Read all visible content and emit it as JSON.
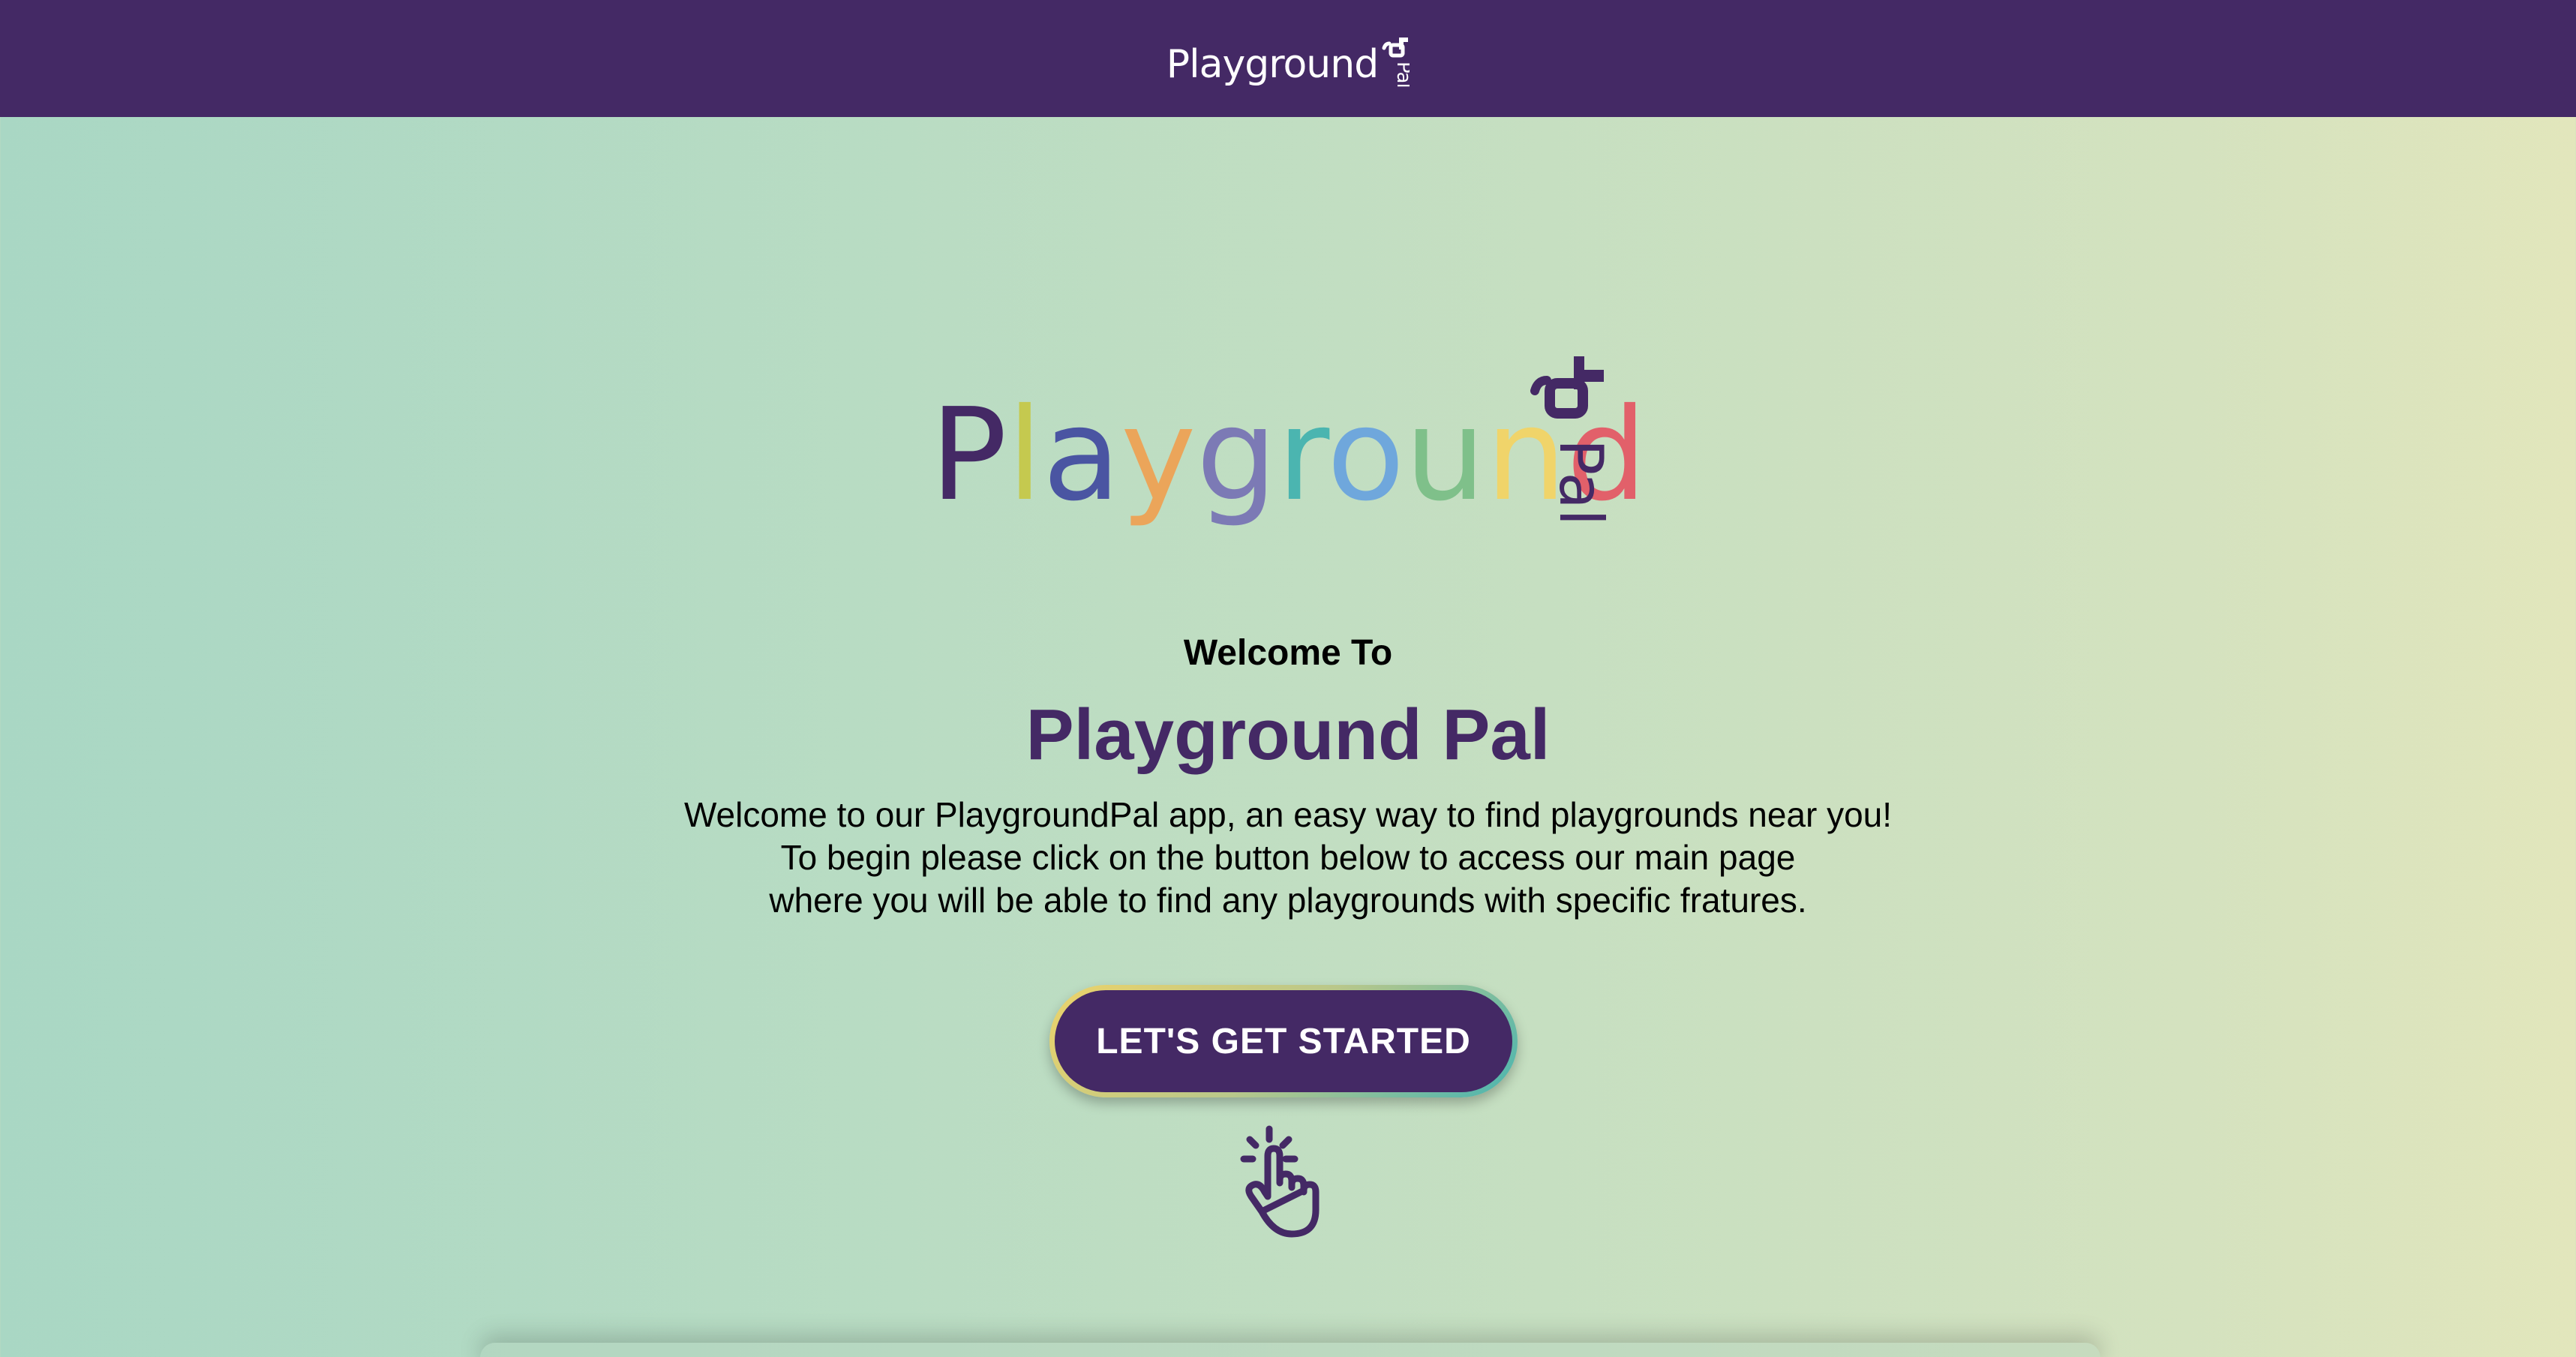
{
  "header": {
    "logo_text": "Playground",
    "logo_suffix": "Pal"
  },
  "hero": {
    "logo_letters": [
      "P",
      "l",
      "a",
      "y",
      "g",
      "r",
      "o",
      "u",
      "n",
      "d"
    ],
    "logo_suffix": "Pal",
    "logo_colors": [
      "#442965",
      "#c5c94f",
      "#4a55a2",
      "#eba55a",
      "#7c7ab5",
      "#4bb5b0",
      "#6fa7dc",
      "#7fc08a",
      "#f0d46a",
      "#e2606a"
    ],
    "welcome_to": "Welcome To",
    "title": "Playground Pal",
    "intro_lines": [
      "Welcome to our PlaygroundPal app, an easy way to find playgrounds near you!",
      "To begin please click on the button below to access our main page",
      "where you will be able to find any playgrounds with specific fratures."
    ]
  },
  "cta": {
    "label": "LET'S GET STARTED"
  },
  "icons": {
    "brand": "slide-icon",
    "pointer": "tap-hand-icon"
  },
  "colors": {
    "brand_purple": "#442965",
    "background_start": "#a9d7c4",
    "background_end": "#e2e6bc"
  }
}
